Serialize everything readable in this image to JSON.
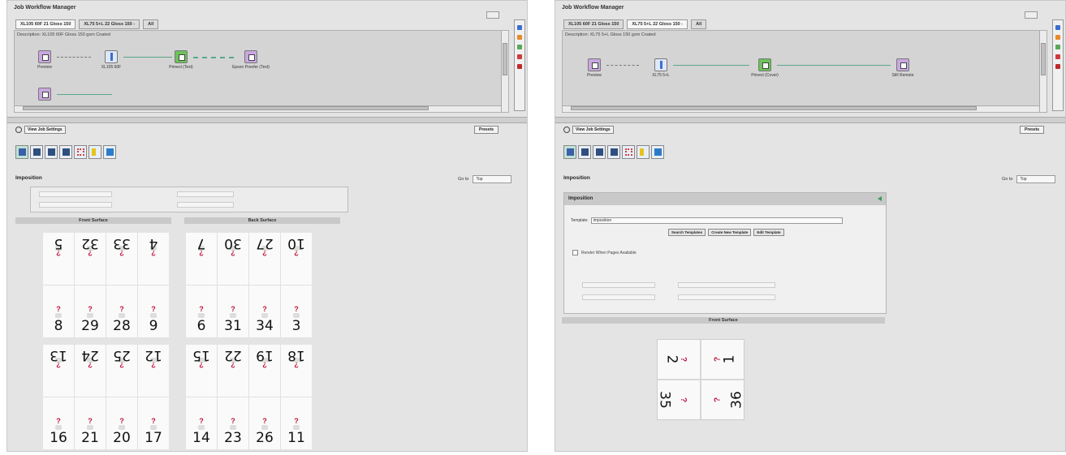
{
  "left": {
    "app_title": "Job Workflow Manager",
    "tabs": [
      "XL105 60F 21 Gloss 150",
      "XL75 5+L 22 Gloss 150 -",
      "All"
    ],
    "description": "Description: XL105 60F Gloss 150 gsm Coated",
    "nodes": [
      {
        "label": "Preview"
      },
      {
        "label": "XL105 60F"
      },
      {
        "label": "Prinect (Text)"
      },
      {
        "label": "Epson Proofer (Text)"
      }
    ],
    "view_settings": "View Job Settings",
    "presets": "Presets",
    "section_title": "Imposition",
    "goto_label": "Go to",
    "goto_value": "Top",
    "front_surface": "Front Surface",
    "back_surface": "Back Surface",
    "front_sheet_1": {
      "top": [
        "5",
        "32",
        "33",
        "4"
      ],
      "bottom": [
        "8",
        "29",
        "28",
        "9"
      ]
    },
    "back_sheet_1": {
      "top": [
        "7",
        "30",
        "27",
        "10"
      ],
      "bottom": [
        "6",
        "31",
        "34",
        "3"
      ]
    },
    "front_sheet_2": {
      "top": [
        "13",
        "24",
        "25",
        "12"
      ],
      "bottom": [
        "16",
        "21",
        "20",
        "17"
      ]
    },
    "back_sheet_2": {
      "top": [
        "15",
        "22",
        "19",
        "18"
      ],
      "bottom": [
        "14",
        "23",
        "26",
        "11"
      ]
    }
  },
  "right": {
    "app_title": "Job Workflow Manager",
    "tabs": [
      "XL105 60F 21 Gloss 150",
      "XL75 5+L 22 Gloss 150 -",
      "All"
    ],
    "description": "Description: XL75 5+L Gloss 150 gsm Coated",
    "nodes": [
      {
        "label": "Preview"
      },
      {
        "label": "XL75 5+L"
      },
      {
        "label": "Prinect (Cover)"
      },
      {
        "label": "Still Remote"
      }
    ],
    "view_settings": "View Job Settings",
    "presets": "Presets",
    "section_title": "Imposition",
    "goto_label": "Go to",
    "goto_value": "Top",
    "panel_title": "Imposition",
    "template_label": "Template:",
    "template_value": "imposition",
    "buttons": [
      "Search Templates",
      "Create New Template",
      "Edit Template"
    ],
    "checkbox_label": "Render When Pages Available",
    "front_surface": "Front Surface",
    "sheet": {
      "top": [
        "2",
        "1"
      ],
      "bottom": [
        "35",
        "36"
      ]
    }
  },
  "colors": {
    "accent_green": "#6cc35a",
    "question_mark": "#c0143c"
  }
}
